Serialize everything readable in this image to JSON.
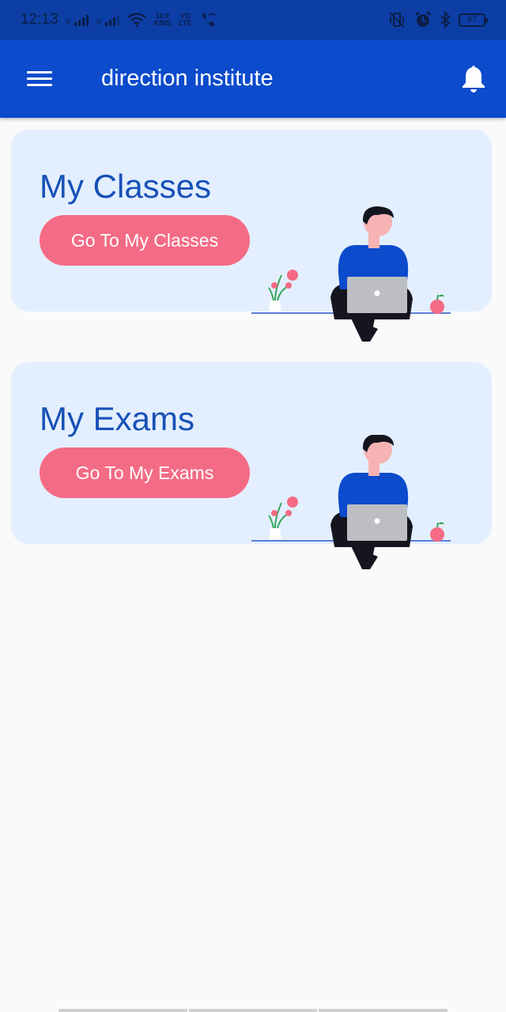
{
  "status_bar": {
    "time": "12:13",
    "network_speed_value": "10.0",
    "network_speed_unit": "KB/S",
    "volte_label_1": "VO",
    "volte_label_2": "LTE",
    "battery_level": "87",
    "icons": [
      "signal-icon",
      "signal-icon",
      "wifi-icon",
      "volte-icon",
      "wifi-calling-icon",
      "vibrate-icon",
      "alarm-icon",
      "bluetooth-icon",
      "battery-icon"
    ]
  },
  "app_bar": {
    "title": "direction institute",
    "menu_icon": "hamburger-menu-icon",
    "notification_icon": "bell-icon",
    "color": "#0b4bcc"
  },
  "cards": [
    {
      "title": "My Classes",
      "button_label": "Go To My Classes",
      "illustration": "person-with-laptop-illustration"
    },
    {
      "title": "My Exams",
      "button_label": "Go To My Exams",
      "illustration": "person-with-laptop-illustration"
    }
  ],
  "colors": {
    "card_background": "#e3efff",
    "card_title": "#1751b8",
    "button": "#f46b85",
    "page_background": "#fafafa"
  }
}
